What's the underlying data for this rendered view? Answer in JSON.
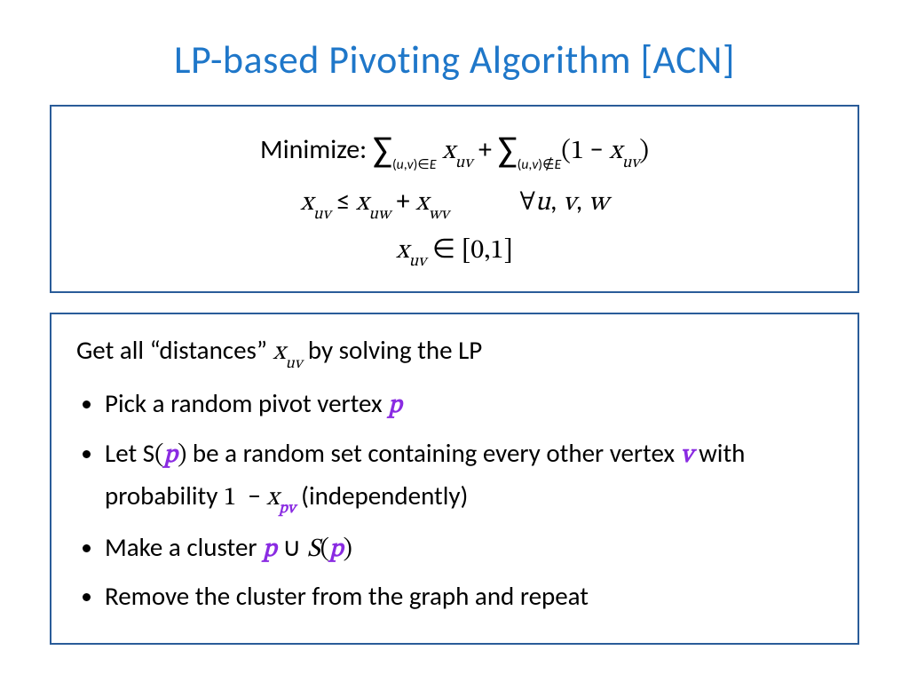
{
  "title": "LP-based Pivoting Algorithm [ACN]",
  "lp": {
    "minimize_label": "Minimize:",
    "objective_html": "<span class='bigop'>∑</span><span class='bisubs'>(<i>u</i>,<i>v</i>)∈<i>E</i></span> <span class='math'>x<span class='subs'>uv</span></span> + <span class='bigop'>∑</span><span class='bisubs'>(<i>u</i>,<i>v</i>)∉<i>E</i></span><span class='math rm'>(</span><span class='math rm'>1</span> − <span class='math'>x<span class='subs'>uv</span></span><span class='math rm'>)</span>",
    "constraint_html": "<span class='math'>x<span class='subs'>uv</span></span> ≤ <span class='math'>x<span class='subs'>uw</span></span> + <span class='math'>x<span class='subs'>wv</span></span><span class='gap'></span><span class='math rm'>∀</span><span class='math'>u</span>, <span class='math'>v</span>, <span class='math'>w</span>",
    "bounds_html": "<span class='math'>x<span class='subs'>uv</span></span> ∈ <span class='math rm'>[0,1]</span>"
  },
  "algo": {
    "intro_html": "Get all “distances” <span class='math'>x<span class='subs'>uv</span></span> by solving the LP",
    "bullets": [
      "Pick a random pivot vertex <span class='p'>p</span>",
      "Let S<span class='math rm'>(</span><span class='p'>p</span><span class='math rm'>)</span> be a random set containing every other vertex <span class='v'>v</span> with probability <span class='math rm'>1</span> &nbsp;− <span class='math'>x</span><span class='subs'><span class='p'>p</span><span class='v'>v</span></span> (independently)",
      "Make a cluster <span class='p'>p</span> ∪ <span class='math'>S</span><span class='math rm'>(</span><span class='p'>p</span><span class='math rm'>)</span>",
      "Remove the cluster from the graph and repeat"
    ]
  }
}
